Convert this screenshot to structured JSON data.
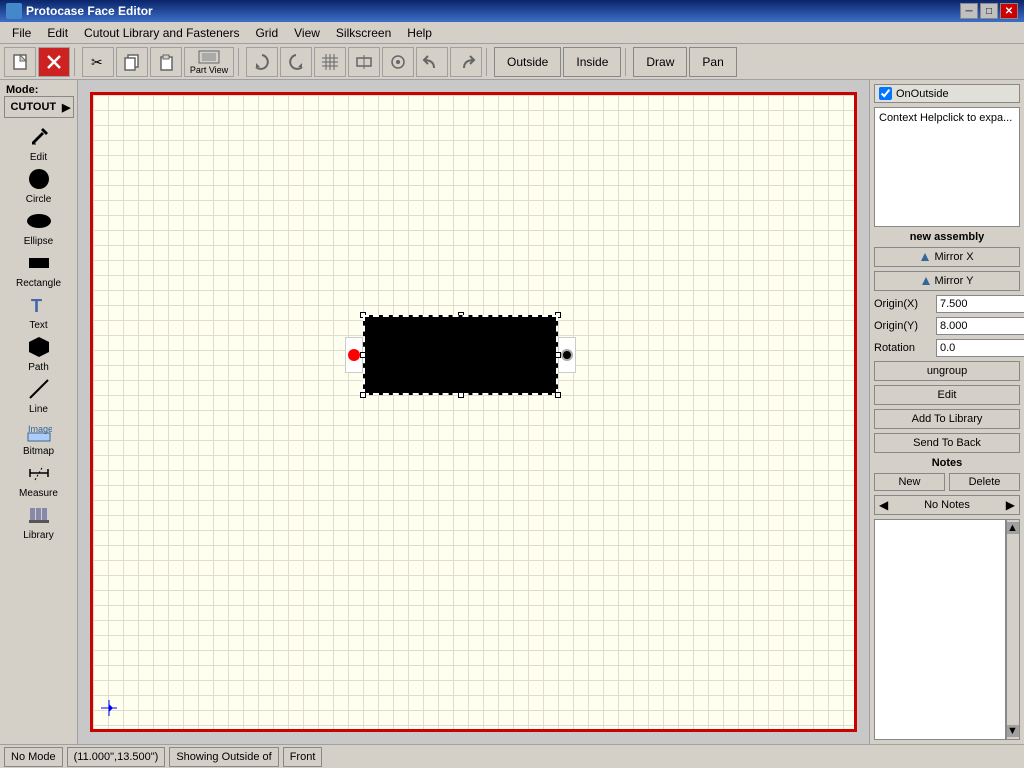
{
  "titlebar": {
    "title": "Protocase Face Editor",
    "minimize": "─",
    "maximize": "□",
    "close": "✕"
  },
  "menubar": {
    "items": [
      "File",
      "Edit",
      "Cutout Library and Fasteners",
      "Grid",
      "View",
      "Silkscreen",
      "Help"
    ]
  },
  "toolbar": {
    "part_view_label": "Part\nView",
    "outside_label": "Outside",
    "inside_label": "Inside",
    "draw_label": "Draw",
    "pan_label": "Pan"
  },
  "left_sidebar": {
    "mode_label": "Mode:",
    "cutout_tag": "CUTOUT",
    "tools": [
      {
        "name": "edit",
        "label": "Edit",
        "icon": "✏"
      },
      {
        "name": "circle",
        "label": "Circle",
        "icon": "⬤"
      },
      {
        "name": "ellipse",
        "label": "Ellipse",
        "icon": "⬭"
      },
      {
        "name": "rectangle",
        "label": "Rectangle",
        "icon": "▬"
      },
      {
        "name": "text",
        "label": "Text",
        "icon": "T"
      },
      {
        "name": "path",
        "label": "Path",
        "icon": "⬠"
      },
      {
        "name": "line",
        "label": "Line",
        "icon": "╱"
      },
      {
        "name": "bitmap",
        "label": "Bitmap",
        "icon": "⊞"
      },
      {
        "name": "measure",
        "label": "Measure",
        "icon": "↔"
      },
      {
        "name": "library",
        "label": "Library",
        "icon": "📚"
      }
    ]
  },
  "right_panel": {
    "on_outside_label": "OnOutside",
    "context_help_text": "Context Help",
    "context_help_sub": "click to expa...",
    "assembly_label": "new assembly",
    "mirror_x_label": "Mirror X",
    "mirror_y_label": "Mirror Y",
    "origin_x_label": "Origin(X)",
    "origin_x_value": "7.500",
    "origin_y_label": "Origin(Y)",
    "origin_y_value": "8.000",
    "rotation_label": "Rotation",
    "rotation_value": "0.0",
    "ungroup_label": "ungroup",
    "edit_label": "Edit",
    "add_to_library_label": "Add To Library",
    "send_to_back_label": "Send To Back",
    "notes_label": "Notes",
    "new_label": "New",
    "delete_label": "Delete",
    "no_notes_label": "No Notes"
  },
  "statusbar": {
    "mode": "No Mode",
    "coords": "(11.000\",13.500\")",
    "showing": "Showing Outside of",
    "view": "Front"
  }
}
